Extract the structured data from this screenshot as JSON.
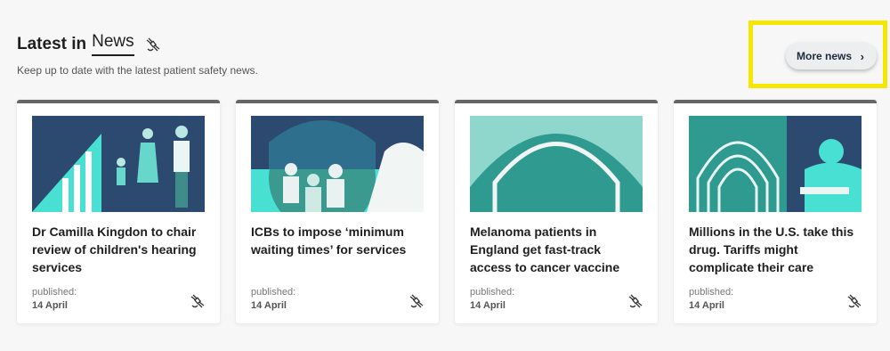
{
  "section": {
    "title_prefix": "Latest in",
    "title_word": "News",
    "title_icon": "satellite-icon",
    "subtitle": "Keep up to date with the latest patient safety news."
  },
  "more_button": {
    "label": "More news",
    "icon": "chevron-right-icon"
  },
  "colors": {
    "teal": "#47e0d2",
    "dark_blue": "#2c4a70",
    "mid_teal": "#2f9a8f",
    "highlight": "#f7e600"
  },
  "cards": [
    {
      "title": "Dr Camilla Kingdon to chair review of children's hearing services",
      "published_label": "published:",
      "date": "14 April"
    },
    {
      "title": "ICBs to impose ‘minimum waiting times’ for services",
      "published_label": "published:",
      "date": "14 April"
    },
    {
      "title": "Melanoma patients in England get fast-track access to cancer vaccine",
      "published_label": "published:",
      "date": "14 April"
    },
    {
      "title": "Millions in the U.S. take this drug. Tariffs might complicate their care",
      "published_label": "published:",
      "date": "14 April"
    }
  ]
}
